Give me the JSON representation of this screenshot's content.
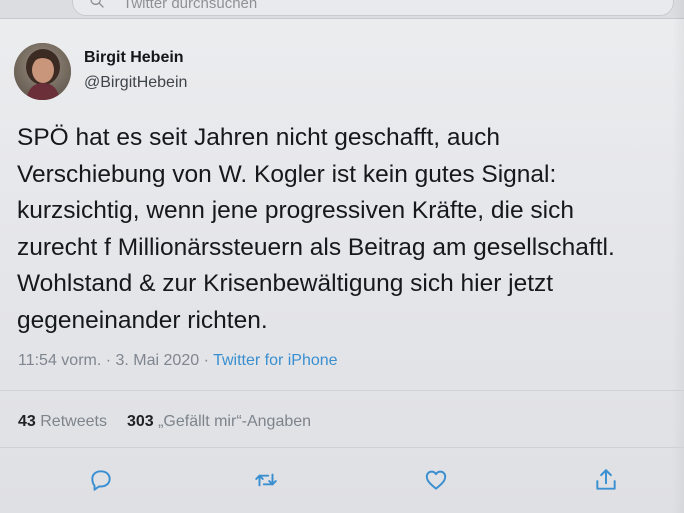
{
  "search": {
    "placeholder": "Twitter durchsuchen"
  },
  "author": {
    "name": "Birgit Hebein",
    "handle": "@BirgitHebein"
  },
  "tweet": {
    "lines": [
      "SPÖ hat es seit Jahren nicht geschafft, auch",
      "Verschiebung von W. Kogler ist kein gutes Signal:",
      "kurzsichtig, wenn jene progressiven Kräfte, die sich",
      "zurecht f Millionärssteuern als Beitrag am gesellschaftl.",
      "Wohlstand & zur Krisenbewältigung sich hier jetzt",
      "gegeneinander richten."
    ]
  },
  "meta": {
    "time": "11:54 vorm.",
    "separator": " · ",
    "date": "3. Mai 2020",
    "source": "Twitter for iPhone"
  },
  "stats": {
    "retweets_count": "43",
    "retweets_label": " Retweets",
    "likes_count": "303",
    "likes_label": " „Gefällt mir“-Angaben"
  },
  "actions": {
    "reply_icon": "reply-icon",
    "retweet_icon": "retweet-icon",
    "like_icon": "like-icon",
    "share_icon": "share-icon"
  },
  "colors": {
    "link": "#3a8fd0",
    "icon": "#3a8fd0",
    "text": "#15181c",
    "muted": "#7f8690"
  }
}
